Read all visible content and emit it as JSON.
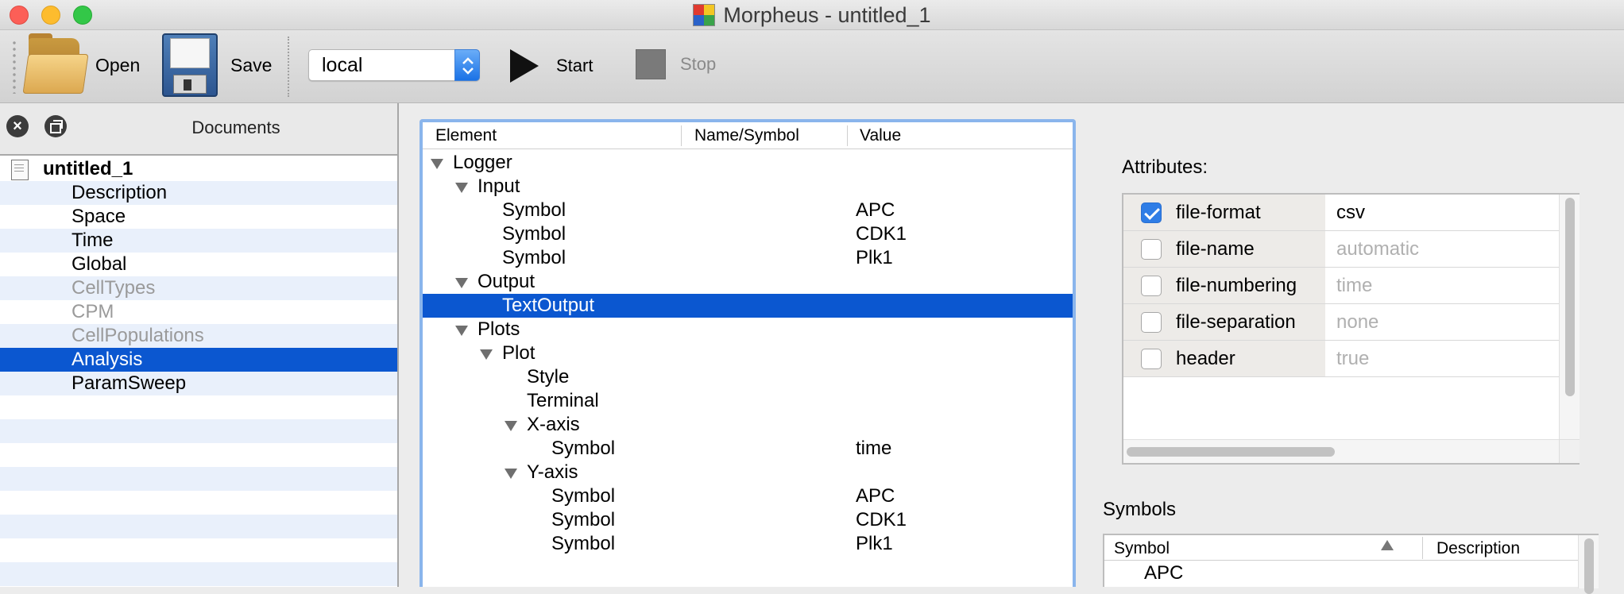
{
  "window": {
    "title": "Morpheus - untitled_1"
  },
  "toolbar": {
    "open_label": "Open",
    "save_label": "Save",
    "host_select": "local",
    "start_label": "Start",
    "stop_label": "Stop"
  },
  "documents": {
    "title": "Documents",
    "root": "untitled_1",
    "items": [
      {
        "label": "Description",
        "enabled": true,
        "selected": false
      },
      {
        "label": "Space",
        "enabled": true,
        "selected": false
      },
      {
        "label": "Time",
        "enabled": true,
        "selected": false
      },
      {
        "label": "Global",
        "enabled": true,
        "selected": false
      },
      {
        "label": "CellTypes",
        "enabled": false,
        "selected": false
      },
      {
        "label": "CPM",
        "enabled": false,
        "selected": false
      },
      {
        "label": "CellPopulations",
        "enabled": false,
        "selected": false
      },
      {
        "label": "Analysis",
        "enabled": true,
        "selected": true
      },
      {
        "label": "ParamSweep",
        "enabled": true,
        "selected": false
      }
    ]
  },
  "tree": {
    "headers": {
      "element": "Element",
      "name": "Name/Symbol",
      "value": "Value"
    },
    "rows": [
      {
        "depth": 0,
        "expandable": true,
        "label": "Logger",
        "value": ""
      },
      {
        "depth": 1,
        "expandable": true,
        "label": "Input",
        "value": ""
      },
      {
        "depth": 2,
        "expandable": false,
        "label": "Symbol",
        "value": "APC"
      },
      {
        "depth": 2,
        "expandable": false,
        "label": "Symbol",
        "value": "CDK1"
      },
      {
        "depth": 2,
        "expandable": false,
        "label": "Symbol",
        "value": "Plk1"
      },
      {
        "depth": 1,
        "expandable": true,
        "label": "Output",
        "value": ""
      },
      {
        "depth": 2,
        "expandable": false,
        "label": "TextOutput",
        "value": "",
        "selected": true
      },
      {
        "depth": 1,
        "expandable": true,
        "label": "Plots",
        "value": ""
      },
      {
        "depth": 2,
        "expandable": true,
        "label": "Plot",
        "value": ""
      },
      {
        "depth": 3,
        "expandable": false,
        "label": "Style",
        "value": ""
      },
      {
        "depth": 3,
        "expandable": false,
        "label": "Terminal",
        "value": ""
      },
      {
        "depth": 3,
        "expandable": true,
        "label": "X-axis",
        "value": ""
      },
      {
        "depth": 4,
        "expandable": false,
        "label": "Symbol",
        "value": "time"
      },
      {
        "depth": 3,
        "expandable": true,
        "label": "Y-axis",
        "value": ""
      },
      {
        "depth": 4,
        "expandable": false,
        "label": "Symbol",
        "value": "APC"
      },
      {
        "depth": 4,
        "expandable": false,
        "label": "Symbol",
        "value": "CDK1"
      },
      {
        "depth": 4,
        "expandable": false,
        "label": "Symbol",
        "value": "Plk1"
      }
    ]
  },
  "attributes": {
    "title": "Attributes:",
    "rows": [
      {
        "name": "file-format",
        "checked": true,
        "value": "csv"
      },
      {
        "name": "file-name",
        "checked": false,
        "value": "automatic"
      },
      {
        "name": "file-numbering",
        "checked": false,
        "value": "time"
      },
      {
        "name": "file-separation",
        "checked": false,
        "value": "none"
      },
      {
        "name": "header",
        "checked": false,
        "value": "true"
      }
    ]
  },
  "symbols": {
    "title": "Symbols",
    "headers": {
      "symbol": "Symbol",
      "description": "Description"
    },
    "rows": [
      {
        "symbol": "APC"
      }
    ]
  },
  "colors": {
    "selection": "#0b57d0",
    "accent": "#2f7de6",
    "alt_row": "#e9f0fb"
  }
}
